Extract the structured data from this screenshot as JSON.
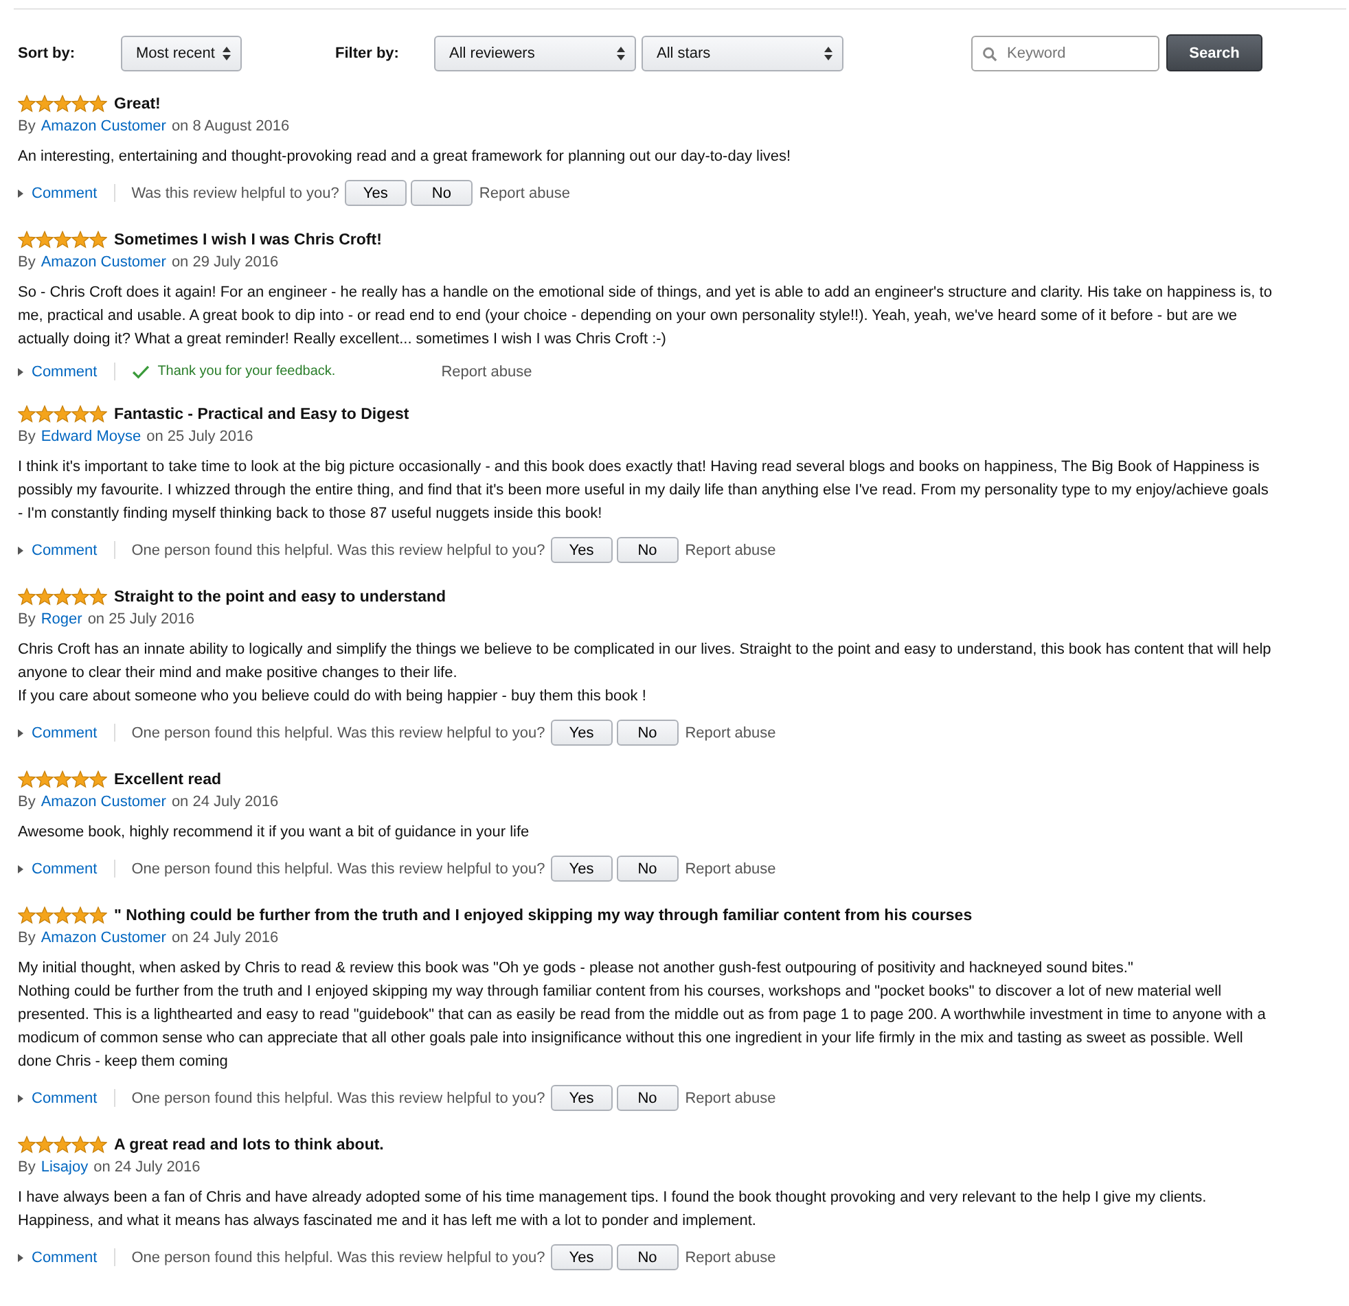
{
  "toolbar": {
    "sort_label": "Sort by:",
    "sort_value": "Most recent",
    "filter_label": "Filter by:",
    "reviewer_filter": "All reviewers",
    "star_filter": "All stars",
    "search_placeholder": "Keyword",
    "search_button": "Search"
  },
  "reviews": [
    {
      "stars": 5,
      "title": "Great!",
      "by": "By",
      "author": "Amazon Customer",
      "date": "on 8 August 2016",
      "body": [
        "An interesting, entertaining and thought-provoking read and a great framework for planning out our day-to-day lives!"
      ],
      "comment": "Comment",
      "feedback": {
        "kind": "ask",
        "question": "Was this review helpful to you?",
        "yes": "Yes",
        "no": "No"
      },
      "report": "Report abuse"
    },
    {
      "stars": 5,
      "title": "Sometimes I wish I was Chris Croft!",
      "by": "By",
      "author": "Amazon Customer",
      "date": "on 29 July 2016",
      "body": [
        "So - Chris Croft does it again! For an engineer - he really has a handle on the emotional side of things, and yet is able to add an engineer's structure and clarity. His take on happiness is, to me, practical and usable. A great book to dip into - or read end to end (your choice - depending on your own personality style!!). Yeah, yeah, we've heard some of it before - but are we actually doing it? What a great reminder! Really excellent... sometimes I wish I was Chris Croft :-)"
      ],
      "comment": "Comment",
      "feedback": {
        "kind": "thanks",
        "message": "Thank you for your feedback."
      },
      "report": "Report abuse"
    },
    {
      "stars": 5,
      "title": "Fantastic - Practical and Easy to Digest",
      "by": "By",
      "author": "Edward Moyse",
      "date": "on 25 July 2016",
      "body": [
        "I think it's important to take time to look at the big picture occasionally - and this book does exactly that! Having read several blogs and books on happiness, The Big Book of Happiness is possibly my favourite. I whizzed through the entire thing, and find that it's been more useful in my daily life than anything else I've read. From my personality type to my enjoy/achieve goals - I'm constantly finding myself thinking back to those 87 useful nuggets inside this book!"
      ],
      "comment": "Comment",
      "feedback": {
        "kind": "ask",
        "question": "One person found this helpful. Was this review helpful to you?",
        "yes": "Yes",
        "no": "No"
      },
      "report": "Report abuse"
    },
    {
      "stars": 5,
      "title": "Straight to the point and easy to understand",
      "by": "By",
      "author": "Roger",
      "date": "on 25 July 2016",
      "body": [
        "Chris Croft has an innate ability to logically and simplify the things we believe to be complicated in our lives. Straight to the point and easy to understand, this book has content that will help anyone to clear their mind and make positive changes to their life.",
        "If you care about someone who you believe could do with being happier - buy them this book !"
      ],
      "comment": "Comment",
      "feedback": {
        "kind": "ask",
        "question": "One person found this helpful. Was this review helpful to you?",
        "yes": "Yes",
        "no": "No"
      },
      "report": "Report abuse"
    },
    {
      "stars": 5,
      "title": "Excellent read",
      "by": "By",
      "author": "Amazon Customer",
      "date": "on 24 July 2016",
      "body": [
        "Awesome book, highly recommend it if you want a bit of guidance in your life"
      ],
      "comment": "Comment",
      "feedback": {
        "kind": "ask",
        "question": "One person found this helpful. Was this review helpful to you?",
        "yes": "Yes",
        "no": "No"
      },
      "report": "Report abuse"
    },
    {
      "stars": 5,
      "title": "\" Nothing could be further from the truth and I enjoyed skipping my way through familiar content from his courses",
      "by": "By",
      "author": "Amazon Customer",
      "date": "on 24 July 2016",
      "body": [
        "My initial thought, when asked by Chris to read & review this book was \"Oh ye gods - please not another gush-fest outpouring of positivity and hackneyed sound bites.\"",
        "Nothing could be further from the truth and I enjoyed skipping my way through familiar content from his courses, workshops and \"pocket books\" to discover a lot of new material well presented. This is a lighthearted and easy to read \"guidebook\" that can as easily be read from the middle out as from page 1 to page 200. A worthwhile investment in time to anyone with a modicum of common sense who can appreciate that all other goals pale into insignificance without this one ingredient in your life firmly in the mix and tasting as sweet as possible. Well done Chris - keep them coming"
      ],
      "comment": "Comment",
      "feedback": {
        "kind": "ask",
        "question": "One person found this helpful. Was this review helpful to you?",
        "yes": "Yes",
        "no": "No"
      },
      "report": "Report abuse"
    },
    {
      "stars": 5,
      "title": "A great read and lots to think about.",
      "by": "By",
      "author": "Lisajoy",
      "date": "on 24 July 2016",
      "body": [
        "I have always been a fan of Chris and have already adopted some of his time management tips. I found the book thought provoking and very relevant to the help I give my clients. Happiness, and what it means has always fascinated me and it has left me with a lot to ponder and implement."
      ],
      "comment": "Comment",
      "feedback": {
        "kind": "ask",
        "question": "One person found this helpful. Was this review helpful to you?",
        "yes": "Yes",
        "no": "No"
      },
      "report": "Report abuse"
    }
  ]
}
